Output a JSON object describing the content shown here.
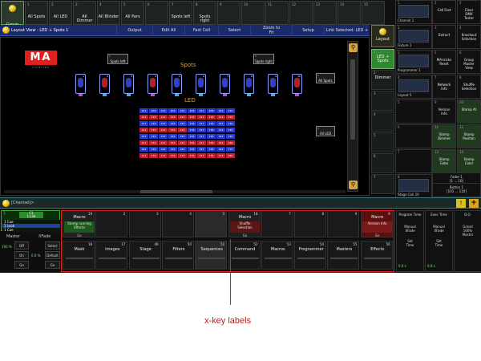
{
  "group_row": {
    "first": {
      "label": "Group"
    },
    "buttons": [
      {
        "num": "1",
        "label": "All Spots"
      },
      {
        "num": "2",
        "label": "All LED"
      },
      {
        "num": "3",
        "label": "All\nDimmer"
      },
      {
        "num": "4",
        "label": "All Blinder"
      },
      {
        "num": "5",
        "label": "All Pars"
      },
      {
        "num": "6",
        "label": ""
      },
      {
        "num": "7",
        "label": "Spots left"
      },
      {
        "num": "8",
        "label": "Spots\nright"
      },
      {
        "num": "9",
        "label": ""
      },
      {
        "num": "10",
        "label": ""
      },
      {
        "num": "11",
        "label": ""
      },
      {
        "num": "12",
        "label": ""
      },
      {
        "num": "13",
        "label": ""
      },
      {
        "num": "14",
        "label": ""
      },
      {
        "num": "15",
        "label": ""
      }
    ]
  },
  "layout_view": {
    "title": "Layout View - LED + Spots 1",
    "toolbar": [
      "Output",
      "Edit All",
      "Fast Cell",
      "Select",
      "Zoom to\nFit",
      "Setup",
      "Link Selected: LED + S"
    ],
    "logo": {
      "big": "MA",
      "small": "LIGHTING"
    },
    "spots_title": "Spots",
    "led_title": "LED",
    "spots_left": {
      "num": "1",
      "label": "Spots left"
    },
    "spots_right": {
      "num": "2",
      "label": "Spots right"
    },
    "all_spots": {
      "num": "1",
      "label": "All Spots"
    },
    "all_led": {
      "num": "2",
      "label": "All LED"
    },
    "spot_numbers": [
      "1",
      "2",
      "3",
      "4",
      "5",
      "6",
      "7",
      "8",
      "9",
      "10"
    ],
    "led_rows": [
      [
        "101",
        "102",
        "103",
        "104",
        "105",
        "106",
        "107",
        "108",
        "109",
        "110"
      ],
      [
        "111",
        "112",
        "113",
        "114",
        "115",
        "116",
        "117",
        "118",
        "119",
        "120"
      ],
      [
        "121",
        "122",
        "123",
        "124",
        "125",
        "126",
        "127",
        "128",
        "129",
        "130"
      ],
      [
        "131",
        "132",
        "133",
        "134",
        "135",
        "136",
        "137",
        "138",
        "139",
        "140"
      ],
      [
        "141",
        "142",
        "143",
        "144",
        "145",
        "146",
        "147",
        "148",
        "149",
        "150"
      ],
      [
        "151",
        "152",
        "153",
        "154",
        "155",
        "156",
        "157",
        "158",
        "159",
        "160"
      ],
      [
        "161",
        "162",
        "163",
        "164",
        "165",
        "166",
        "167",
        "168",
        "169",
        "170"
      ],
      [
        "171",
        "172",
        "173",
        "174",
        "175",
        "176",
        "177",
        "178",
        "179",
        "180"
      ]
    ]
  },
  "right_column": {
    "layout": "Layout",
    "items": [
      {
        "num": "1",
        "label": "LED +\nSpots"
      },
      {
        "num": "2",
        "label": "Dimmer"
      },
      {
        "num": "3",
        "label": ""
      },
      {
        "num": "4",
        "label": ""
      },
      {
        "num": "5",
        "label": ""
      },
      {
        "num": "6",
        "label": ""
      },
      {
        "num": "7",
        "label": ""
      }
    ]
  },
  "views": [
    {
      "num": "1",
      "label": "Channel 1"
    },
    {
      "num": "2",
      "label": "Fixture 1"
    },
    {
      "num": "3",
      "label": "Programmer 1"
    },
    {
      "num": "4",
      "label": "Layout 5"
    },
    {
      "num": "5",
      "label": ""
    },
    {
      "num": "6",
      "label": ""
    },
    {
      "num": "7",
      "label": ""
    },
    {
      "num": "8",
      "label": "Stage Cali 20"
    }
  ],
  "macros": [
    {
      "num": "1",
      "label": "Call Fast",
      "green": false
    },
    {
      "num": "2",
      "label": "Clear\nDMX\nTester",
      "green": false
    },
    {
      "num": "3",
      "label": "Extract",
      "green": false
    },
    {
      "num": "4",
      "label": "Knockout\nSelection",
      "green": false
    },
    {
      "num": "5",
      "label": "MA-tricks\nReset",
      "green": false
    },
    {
      "num": "6",
      "label": "Group\nMaster\nView",
      "green": false
    },
    {
      "num": "7",
      "label": "Network\nInfo",
      "green": false
    },
    {
      "num": "8",
      "label": "Shuffle\nSelection",
      "green": false
    },
    {
      "num": "9",
      "label": "Version\nInfo",
      "green": false
    },
    {
      "num": "10",
      "label": "Stomp At",
      "green": true
    },
    {
      "num": "11",
      "label": "Stomp\nDimmer",
      "green": true
    },
    {
      "num": "12",
      "label": "Stomp\nPosition",
      "green": true
    },
    {
      "num": "13",
      "label": "Stomp\nGobo",
      "green": true
    },
    {
      "num": "14",
      "label": "Stomp\nColor",
      "green": true
    }
  ],
  "fader_panel": {
    "fader": "Fader 1\n[1 ... 10]",
    "button": "Button 1\n[101 ... 110]"
  },
  "command_line": {
    "label": "[Channel]>"
  },
  "sequence_panel": {
    "exec": "1",
    "cue_name": "C1\n1.Lnk",
    "cue_list": [
      "1 Cue",
      "1 Look",
      "1 Cue"
    ],
    "master": "Master",
    "xfade": "XFade",
    "percent1": "100 %",
    "percent2": "0.0 %",
    "off": "Off",
    "on": "On",
    "go": "Go",
    "select": "Select",
    "default": "Default",
    "go2": "Go"
  },
  "xkeys_top": [
    {
      "num": "19",
      "head": "Macro",
      "body": "Stomp running\nEffects",
      "tag": "Go"
    },
    {
      "num": "2",
      "head": "",
      "body": "",
      "tag": ""
    },
    {
      "num": "3",
      "head": "",
      "body": "",
      "tag": ""
    },
    {
      "num": "4",
      "head": "",
      "body": "",
      "tag": ""
    },
    {
      "num": "5",
      "head": "",
      "body": "",
      "tag": ""
    },
    {
      "num": "18",
      "head": "Macro",
      "body": "Shuffle\nSelection",
      "tag": "Go"
    },
    {
      "num": "7",
      "head": "",
      "body": "",
      "tag": ""
    },
    {
      "num": "8",
      "head": "",
      "body": "",
      "tag": ""
    },
    {
      "num": "9",
      "head": "",
      "body": "",
      "tag": ""
    },
    {
      "num": "9",
      "head": "Macro",
      "body": "Version Info",
      "tag": "Go"
    }
  ],
  "xkeys_bottom": [
    {
      "num": "18",
      "label": "Mask"
    },
    {
      "num": "17",
      "label": "Images"
    },
    {
      "num": "49",
      "label": "Stage"
    },
    {
      "num": "50",
      "label": "Filters"
    },
    {
      "num": "51",
      "label": "Sequences"
    },
    {
      "num": "52",
      "label": "Command"
    },
    {
      "num": "53",
      "label": "Macros"
    },
    {
      "num": "54",
      "label": "Programmer"
    },
    {
      "num": "55",
      "label": "Masters"
    },
    {
      "num": "56",
      "label": "Effects"
    }
  ],
  "fader_bank": [
    {
      "title": "Program Time",
      "sub": "Manual\nXFade",
      "btn": "Set\nTime",
      "val": "0.0 s"
    },
    {
      "title": "Exec Time",
      "sub": "Manual\nXFade",
      "btn": "Set\nTime",
      "val": "0.0 s"
    },
    {
      "title": "D.O.",
      "sub": "Grand\n100%\nMaster",
      "btn": "",
      "val": ""
    }
  ],
  "callout": {
    "text": "x-key labels"
  },
  "colors": {
    "accent_red": "#e02020",
    "spot_blue": "#8aa0ff",
    "title_blue": "#1a2a6a"
  }
}
